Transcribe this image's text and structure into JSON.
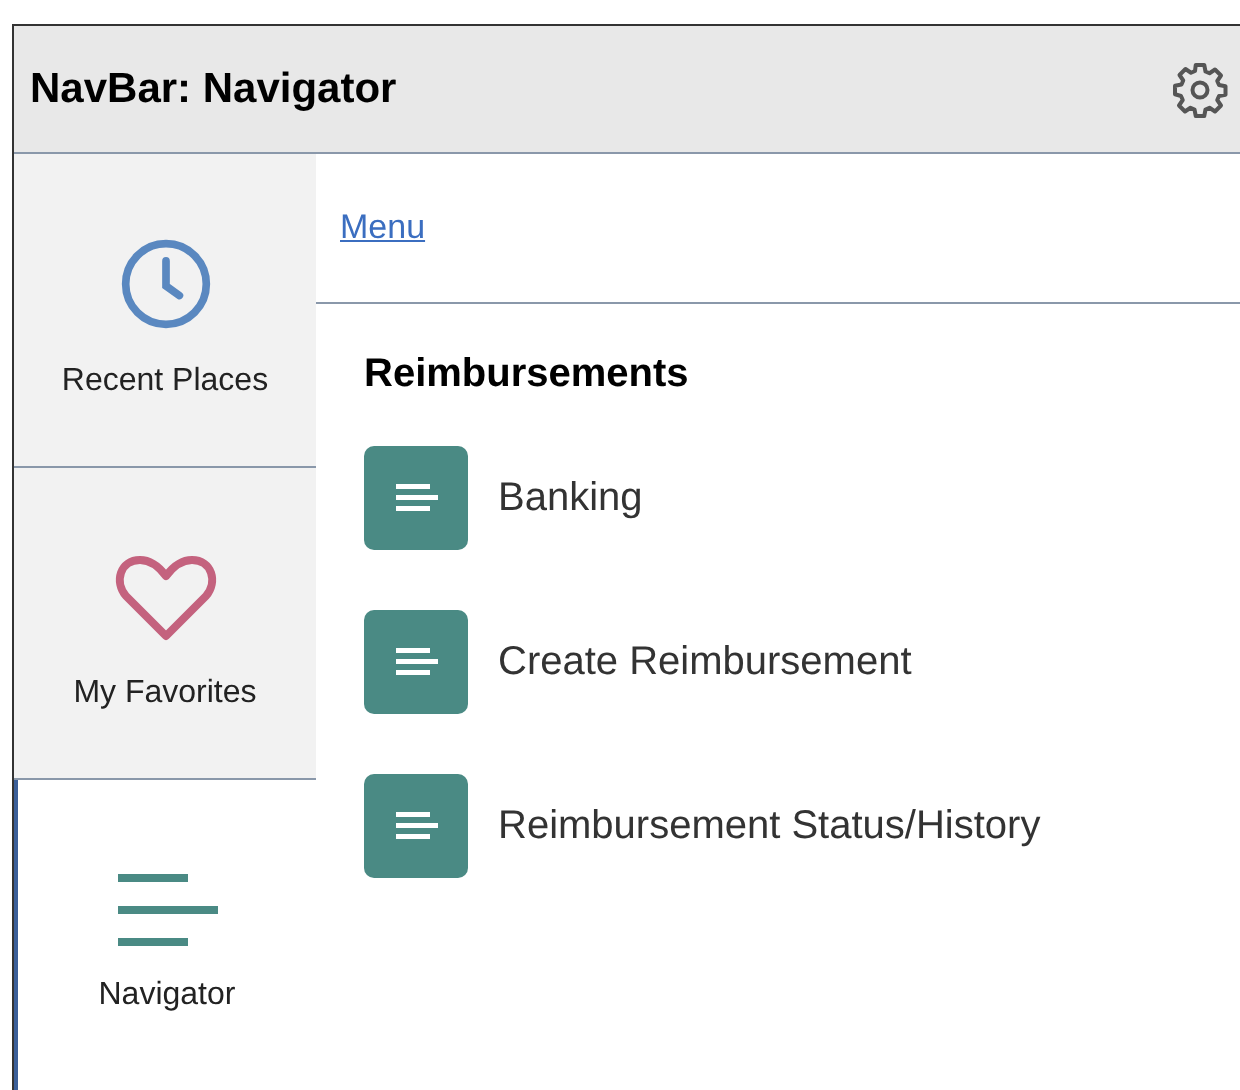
{
  "header": {
    "title": "NavBar: Navigator"
  },
  "sidebar": {
    "items": [
      {
        "label": "Recent Places",
        "kind": "clock",
        "selected": false
      },
      {
        "label": "My Favorites",
        "kind": "heart",
        "selected": false
      },
      {
        "label": "Navigator",
        "kind": "lines",
        "selected": true
      }
    ]
  },
  "breadcrumb": {
    "link": "Menu"
  },
  "section": {
    "title": "Reimbursements",
    "items": [
      {
        "label": "Banking"
      },
      {
        "label": "Create Reimbursement"
      },
      {
        "label": "Reimbursement Status/History"
      }
    ]
  }
}
